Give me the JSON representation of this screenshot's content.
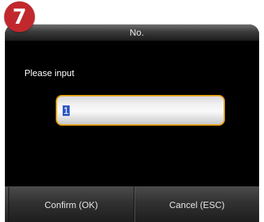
{
  "badge": {
    "step": "7",
    "color": "#c1282d"
  },
  "title_bar": {
    "title": "No."
  },
  "form": {
    "prompt": "Please input",
    "input_value": "1",
    "input_border_color": "#e8a413"
  },
  "buttons": {
    "confirm_label": "Confirm (OK)",
    "cancel_label": "Cancel (ESC)"
  }
}
